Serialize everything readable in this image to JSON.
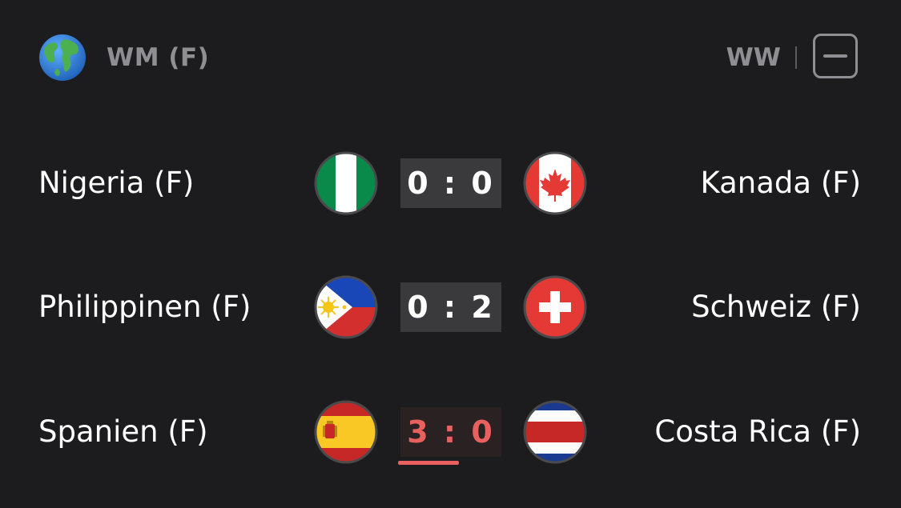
{
  "header": {
    "globe_icon": "globe-icon",
    "league_name": "WM (F)",
    "gender_code": "WW",
    "collapse_icon": "minus-square-icon"
  },
  "matches": [
    {
      "home": "Nigeria (F)",
      "away": "Kanada (F)",
      "score": "0 : 0",
      "home_flag": "nigeria-flag-icon",
      "away_flag": "canada-flag-icon",
      "live": false
    },
    {
      "home": "Philippinen (F)",
      "away": "Schweiz (F)",
      "score": "0 : 2",
      "home_flag": "philippines-flag-icon",
      "away_flag": "switzerland-flag-icon",
      "live": false
    },
    {
      "home": "Spanien (F)",
      "away": "Costa Rica (F)",
      "score": "3 : 0",
      "home_flag": "spain-flag-icon",
      "away_flag": "costa-rica-flag-icon",
      "live": true,
      "live_color": "#e8615f"
    }
  ],
  "colors": {
    "background": "#1c1c1e",
    "score_box": "#3a3a3c",
    "muted_text": "#8e8e93",
    "live_accent": "#e8615f"
  }
}
